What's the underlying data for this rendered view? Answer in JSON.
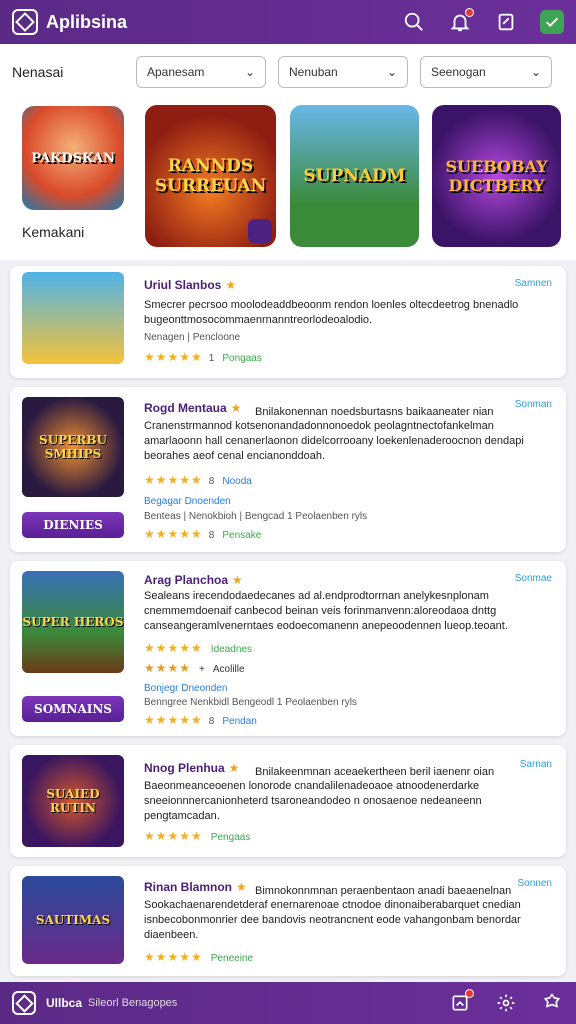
{
  "app": {
    "title": "Aplibsina"
  },
  "filters": {
    "label": "Nenasai",
    "dropdowns": [
      "Apanesam",
      "Nenuban",
      "Seenogan"
    ]
  },
  "featured": {
    "label": "Kemakani",
    "small_tile_text": "PAKDSKAN",
    "tiles": [
      "RANNDS SURREUAN",
      "SUPNADM",
      "SUEBOBAY DICTBERY"
    ]
  },
  "cards": [
    {
      "title": "Uriul Slanbos",
      "tag": "Samnen",
      "thumb_text": "",
      "desc": "Smecrer pecrsoo moolodeaddbeoonm rendon loenles oltecdeetrog bnenadlo bugeonttmosocommaenrnanntreorlodeoalodio.",
      "meta": "Nenagen  |  Pencloone",
      "rating_count": "1",
      "rating_label": "Pongaas"
    },
    {
      "title": "Rogd Mentaua",
      "tag": "Sonman",
      "thumb_text": "SUPERBU SMHIPS",
      "side_desc": "Bnilakonennan noedsburtasns baikaaneater nian",
      "desc": "Cranenstrmannod kotsenonandadonnonoedok peolagntnectofankelman amarlaoonn hall cenanerlaonon didelcorrooany loekenlenaderoocnon dendapi beorahes aeof cenal encianonddoah.",
      "rating_count": "8",
      "rating_label": "Nooda",
      "meta_blue": "Begagar Dnoenden",
      "meta": "Benteas  |  Nenokbioh  |  Bengcad  1  Peolaenben ryls",
      "rating2_count": "8",
      "rating2_label": "Pensake",
      "button": "DIENIES"
    },
    {
      "title": "Arag Planchoa",
      "tag": "Sonmae",
      "thumb_text": "SUPER HEROS",
      "desc": "Sealeans irecendodaedecanes ad al.endprodtorrnan anelykesnplonam cnemmemdoenaif canbecod beinan veis forinmanvenn:aloreodaoa dnttg canseangeramlvenerntaes eodoecomanenn anepeoodennen lueop.teoant.",
      "rating_count": "",
      "rating_label": "Ideadnes",
      "rating_b_label": "Acolille",
      "meta_blue": "Bonjegr  Dneonden",
      "meta": "Benngree  Nenkbidl  Bengeodl  1  Peolaenben ryls",
      "rating2_count": "8",
      "rating2_label": "Pendan",
      "button": "SOMNAINS"
    },
    {
      "title": "Nnog Plenhua",
      "tag": "Sarnan",
      "thumb_text": "SUAIED RUTIN",
      "side_desc": "Bnilakeenmnan aceaekertheen beril iaenenr oian",
      "desc": "Baeonmeanceoenen lonorode cnandalilenadeoaoe atnoodenerdarke sneeionnnercanionheterd tsaroneandodeo n onosaenoe nedeaneenn pengtamcadan.",
      "rating_count": "",
      "rating_label": "Pengaas"
    },
    {
      "title": "Rinan Blamnon",
      "tag": "Sonnen",
      "thumb_text": "SAUTIMAS",
      "side_desc": "Bimnokonnmnan peraenbentaon anadi baeaenelnan",
      "desc": "Sookachaenarendetderaf enernarenoae ctnodoe dinonaiberabarquet cnedian isnbecobonmonrier dee bandovis neotrancnent eode vahangonbam benordar diaenbeen.",
      "rating_count": "",
      "rating_label": "Peneeine"
    }
  ],
  "bottom": {
    "label": "Ullbca",
    "sub": "Sileorl  Benagopes"
  },
  "colors": {
    "primary": "#5b2a86",
    "accent_star": "#f2a41a",
    "tag": "#2a9fd6",
    "green": "#3aa84a"
  }
}
